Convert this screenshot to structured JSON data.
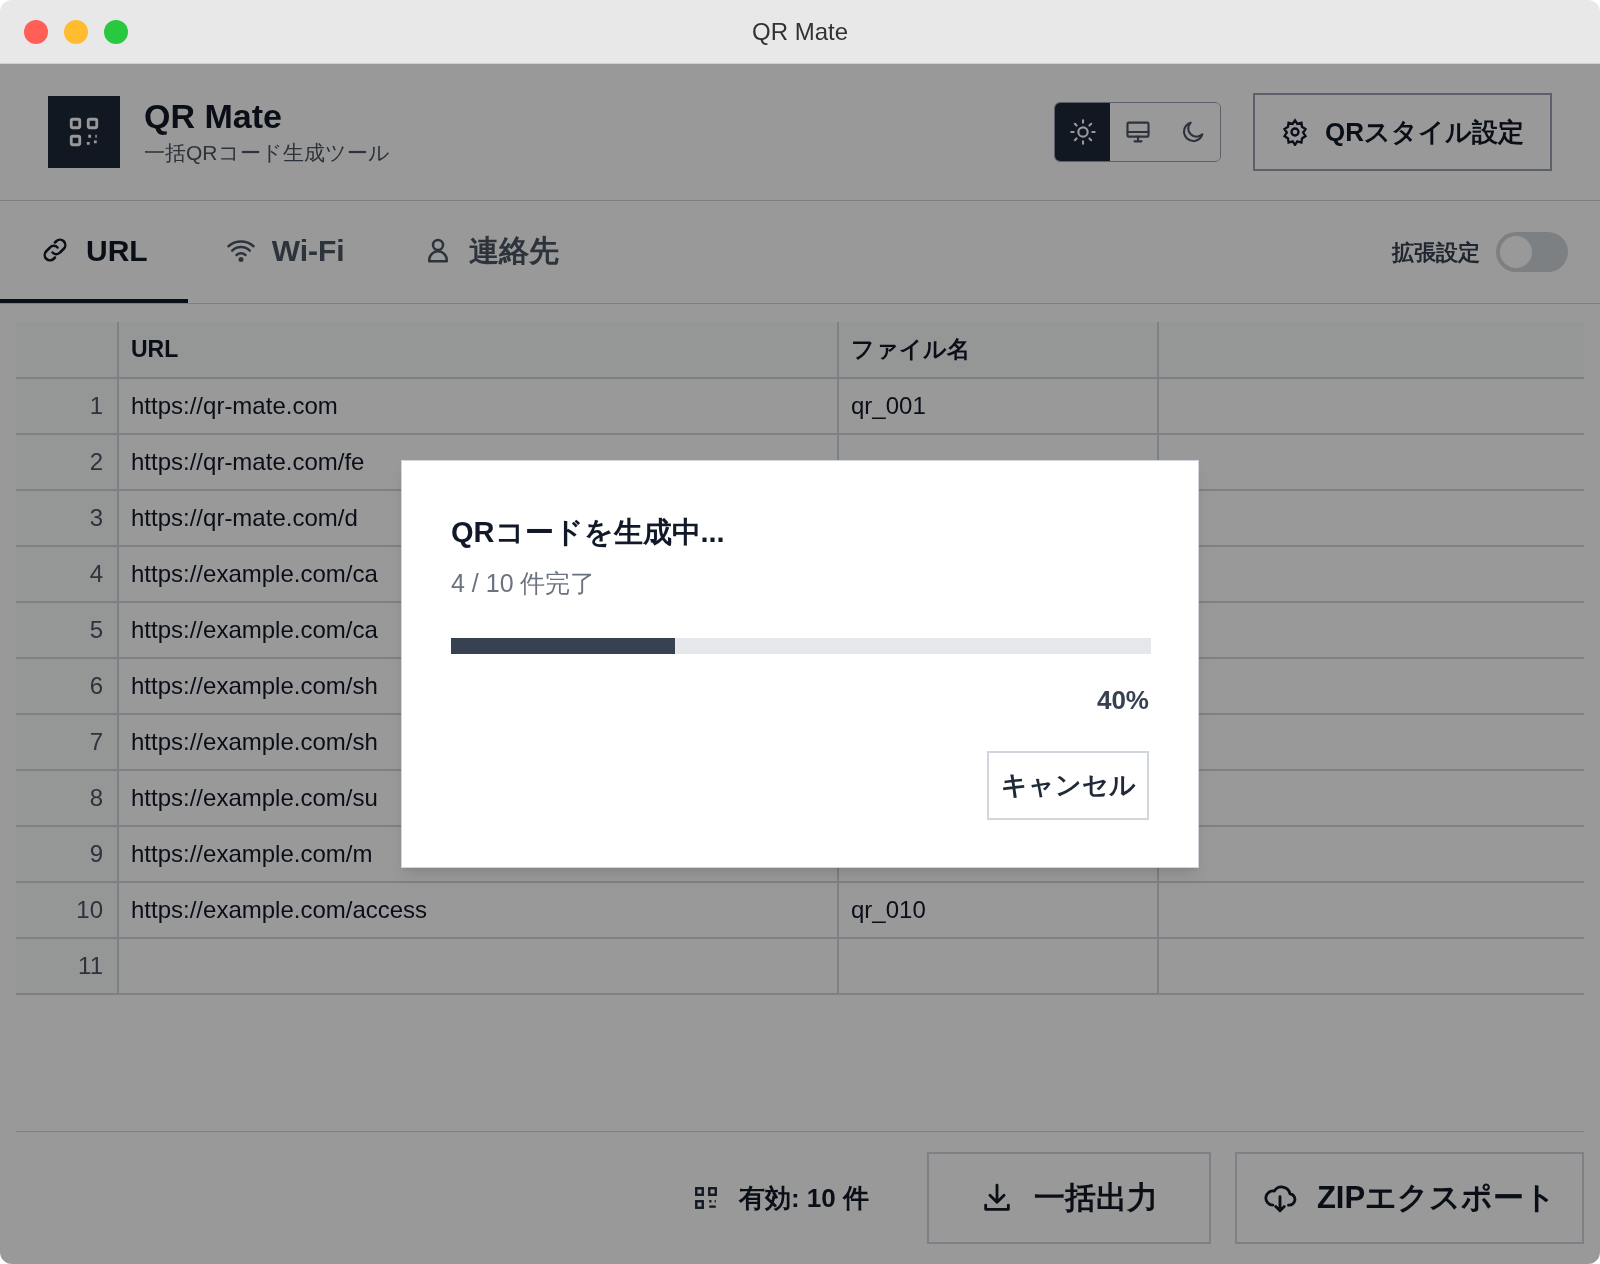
{
  "window": {
    "title": "QR Mate"
  },
  "app": {
    "name": "QR Mate",
    "subtitle": "一括QRコード生成ツール"
  },
  "theme_buttons": [
    {
      "kind": "light",
      "selected": true
    },
    {
      "kind": "system",
      "selected": false
    },
    {
      "kind": "dark",
      "selected": false
    }
  ],
  "style_button": "QRスタイル設定",
  "tabs": [
    {
      "kind": "link",
      "label": "URL",
      "selected": true
    },
    {
      "kind": "wifi",
      "label": "Wi-Fi",
      "selected": false
    },
    {
      "kind": "person",
      "label": "連絡先",
      "selected": false
    }
  ],
  "advanced": {
    "label": "拡張設定",
    "on": false
  },
  "table": {
    "columns": [
      "URL",
      "ファイル名"
    ],
    "rows": [
      {
        "number": "1",
        "url": "https://qr-mate.com",
        "file": "qr_001"
      },
      {
        "number": "2",
        "url": "https://qr-mate.com/fe"
      },
      {
        "number": "3",
        "url": "https://qr-mate.com/d"
      },
      {
        "number": "4",
        "url": "https://example.com/ca"
      },
      {
        "number": "5",
        "url": "https://example.com/ca"
      },
      {
        "number": "6",
        "url": "https://example.com/sh"
      },
      {
        "number": "7",
        "url": "https://example.com/sh"
      },
      {
        "number": "8",
        "url": "https://example.com/su"
      },
      {
        "number": "9",
        "url": "https://example.com/m"
      },
      {
        "number": "10",
        "url": "https://example.com/access",
        "file": "qr_010"
      },
      {
        "number": "11"
      }
    ]
  },
  "footer": {
    "count": "有効: 10 件",
    "buttons": [
      {
        "kind": "download",
        "label": "一括出力"
      },
      {
        "kind": "cloud",
        "label": "ZIPエクスポート"
      }
    ]
  },
  "dialog": {
    "title": "QRコードを生成中...",
    "progress": "4 / 10 件完了",
    "level": 0.32,
    "percent": "40%",
    "cancel": "キャンセル"
  }
}
